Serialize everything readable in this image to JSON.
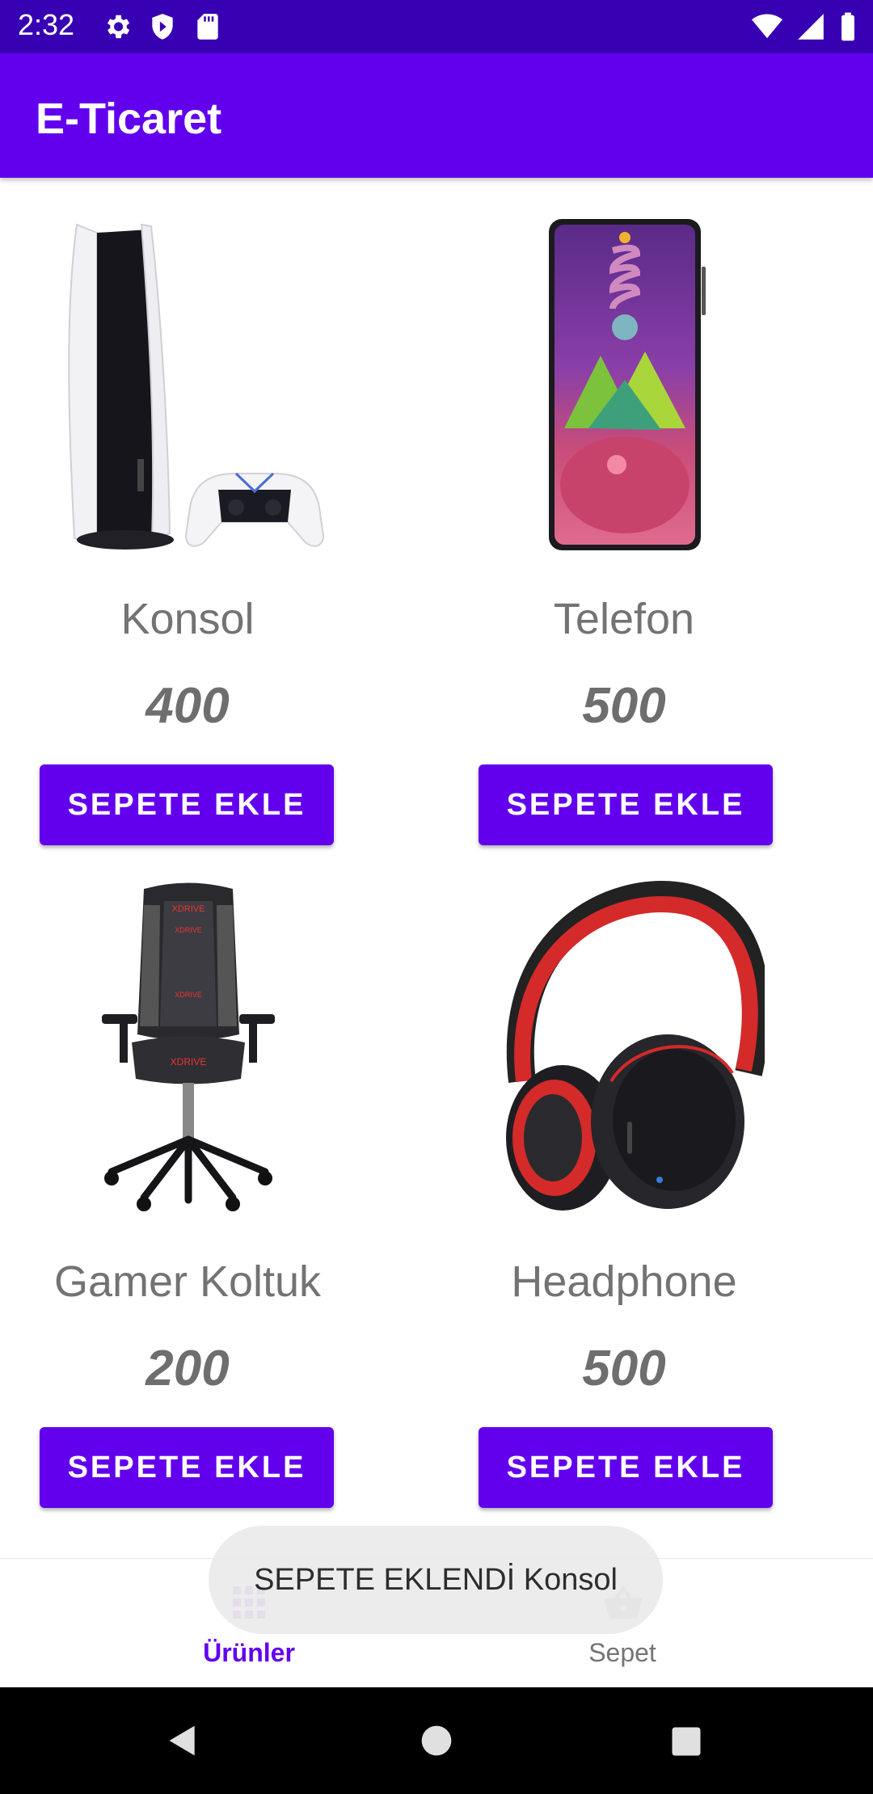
{
  "status_bar": {
    "time": "2:32",
    "left_icons": [
      "gear-icon",
      "shield-icon",
      "sd-card-icon"
    ],
    "right_icons": [
      "wifi-icon",
      "signal-icon",
      "battery-icon"
    ]
  },
  "app_bar": {
    "title": "E-Ticaret"
  },
  "products": [
    {
      "name": "Konsol",
      "price": "400",
      "button": "SEPETE EKLE",
      "image": "game-console-image"
    },
    {
      "name": "Telefon",
      "price": "500",
      "button": "SEPETE EKLE",
      "image": "smartphone-image"
    },
    {
      "name": "Gamer Koltuk",
      "price": "200",
      "button": "SEPETE EKLE",
      "image": "gaming-chair-image"
    },
    {
      "name": "Headphone",
      "price": "500",
      "button": "SEPETE EKLE",
      "image": "headphone-image"
    }
  ],
  "bottom_nav": {
    "items": [
      {
        "label": "Ürünler",
        "icon": "grid-icon",
        "selected": true
      },
      {
        "label": "Sepet",
        "icon": "basket-icon",
        "selected": false
      }
    ],
    "active_color": "#6200ee",
    "inactive_color": "#757575"
  },
  "toast": {
    "message": "SEPETE EKLENDİ Konsol"
  },
  "colors": {
    "primary": "#6200ee",
    "primary_dark": "#3700b3"
  }
}
